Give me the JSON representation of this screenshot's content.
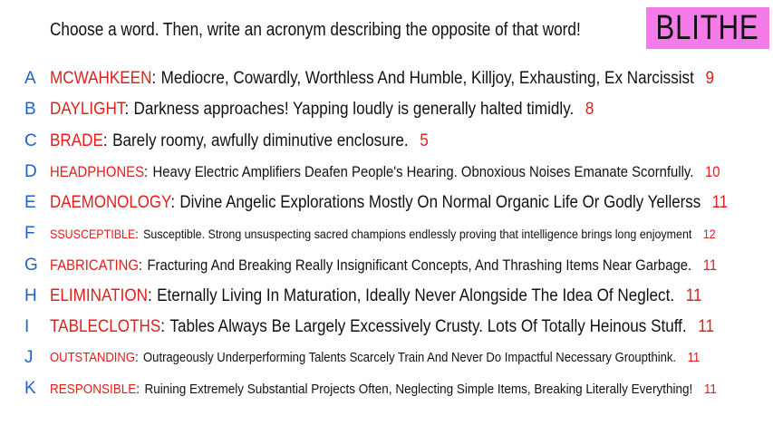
{
  "prompt": "Choose a word. Then, write an acronym describing the opposite of that word!",
  "badge": "BLITHE",
  "colors": {
    "word": "#e0201c",
    "letter": "#1e63c9",
    "badge_bg": "#f57be8"
  },
  "entries": [
    {
      "letter": "A",
      "word": "MCWAHKEEN",
      "sep": ":",
      "acronym": "Mediocre, Cowardly, Worthless And Humble, Killjoy, Exhausting, Ex Narcissist",
      "count": "9"
    },
    {
      "letter": "B",
      "word": "DAYLIGHT",
      "sep": ":",
      "acronym": "Darkness approaches! Yapping loudly is generally halted timidly.",
      "count": "8"
    },
    {
      "letter": "C",
      "word": "BRADE",
      "sep": ":",
      "acronym": "Barely roomy, awfully diminutive enclosure.",
      "count": "5"
    },
    {
      "letter": "D",
      "word": "HEADPHONES",
      "sep": ":",
      "acronym": "Heavy Electric Amplifiers Deafen People's Hearing. Obnoxious Noises Emanate Scornfully.",
      "count": "10"
    },
    {
      "letter": "E",
      "word": "DAEMONOLOGY",
      "sep": ":",
      "acronym": "Divine Angelic Explorations Mostly On Normal Organic Life Or Godly Yellerss",
      "count": "11"
    },
    {
      "letter": "F",
      "word": "SSUSCEPTIBLE",
      "sep": ":",
      "acronym": "Susceptible. Strong unsuspecting sacred champions endlessly proving that intelligence brings long enjoyment",
      "count": "12"
    },
    {
      "letter": "G",
      "word": "FABRICATING",
      "sep": ":",
      "acronym": "Fracturing And Breaking Really Insignificant Concepts, And Thrashing Items Near Garbage.",
      "count": "11"
    },
    {
      "letter": "H",
      "word": "ELIMINATION",
      "sep": ":",
      "acronym": "Eternally Living In Maturation, Ideally Never Alongside The Idea Of Neglect.",
      "count": "11"
    },
    {
      "letter": "I",
      "word": "TABLECLOTHS",
      "sep": ":",
      "acronym": "Tables Always Be Largely Excessively Crusty. Lots Of Totally Heinous Stuff.",
      "count": "11"
    },
    {
      "letter": "J",
      "word": "OUTSTANDING",
      "sep": ":",
      "acronym": "Outrageously Underperforming Talents Scarcely Train And Never Do Impactful Necessary Groupthink.",
      "count": "11"
    },
    {
      "letter": "K",
      "word": "RESPONSIBLE",
      "sep": ":",
      "acronym": "Ruining Extremely Substantial Projects Often, Neglecting Simple Items, Breaking Literally Everything!",
      "count": "11"
    }
  ]
}
